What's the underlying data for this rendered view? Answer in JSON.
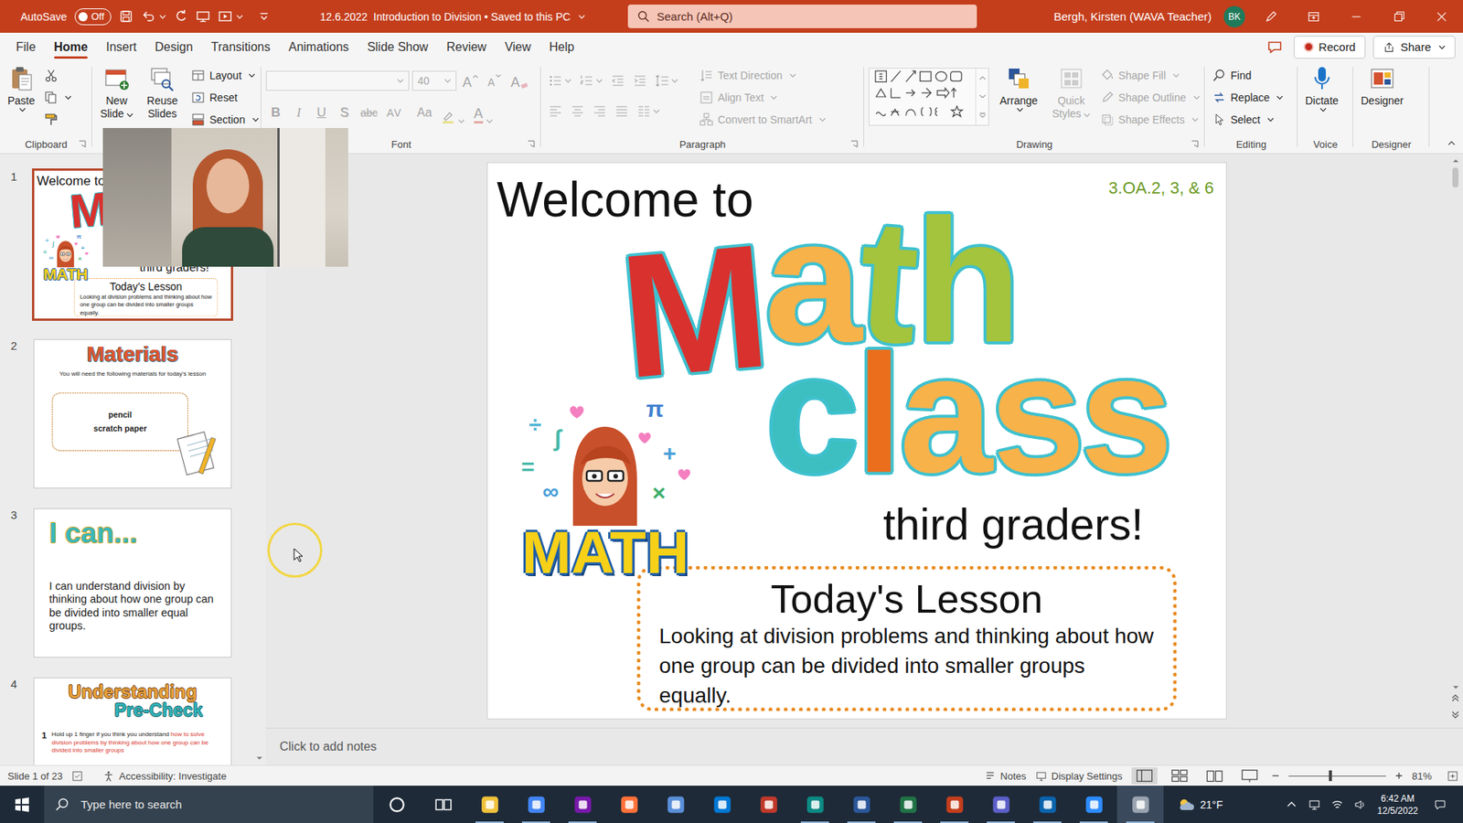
{
  "window": {
    "autosave_label": "AutoSave",
    "autosave": {
      "label": "Off",
      "on": false
    },
    "title": "12.6.2022  Introduction to Division • Saved to this PC",
    "search_placeholder": "Search (Alt+Q)",
    "user": "Bergh, Kirsten (WAVA Teacher)",
    "initials": "BK"
  },
  "menu": {
    "tabs": [
      {
        "label": "File",
        "selected": false
      },
      {
        "label": "Home",
        "selected": true
      },
      {
        "label": "Insert",
        "selected": false
      },
      {
        "label": "Design",
        "selected": false
      },
      {
        "label": "Transitions",
        "selected": false
      },
      {
        "label": "Animations",
        "selected": false
      },
      {
        "label": "Slide Show",
        "selected": false
      },
      {
        "label": "Review",
        "selected": false
      },
      {
        "label": "View",
        "selected": false
      },
      {
        "label": "Help",
        "selected": false
      }
    ],
    "record": "Record",
    "share": "Share"
  },
  "ribbon": {
    "clipboard": {
      "label": "Clipboard",
      "paste": "Paste"
    },
    "slides": {
      "new_slide": "New Slide",
      "reuse_slides": "Reuse Slides",
      "layout": "Layout",
      "reset": "Reset",
      "section": "Section"
    },
    "font": {
      "label": "Font",
      "disabled": true,
      "size": "40",
      "grow": "A",
      "shrink": "A",
      "clear": "A",
      "formats": [
        "B",
        "I",
        "U",
        "S",
        "abc",
        "AV",
        "Aa"
      ],
      "color": "A"
    },
    "paragraph": {
      "label": "Paragraph",
      "disabled": true,
      "text_direction": "Text Direction",
      "align_text": "Align Text",
      "smartart": "Convert to SmartArt"
    },
    "drawing": {
      "label": "Drawing",
      "arrange": "Arrange",
      "quick_styles": "Quick Styles",
      "quick_styles_disabled": true,
      "shape_fill": "Shape Fill",
      "shape_outline": "Shape Outline",
      "shape_effects": "Shape Effects",
      "shape_format_disabled": true
    },
    "editing": {
      "label": "Editing",
      "find": "Find",
      "replace": "Replace",
      "select": "Select"
    },
    "voice": {
      "label": "Voice",
      "dictate": "Dictate"
    },
    "designer": {
      "label": "Designer",
      "designer": "Designer"
    }
  },
  "thumbnails": [
    {
      "number": "1",
      "selected": true,
      "kind": "title"
    },
    {
      "number": "2",
      "selected": false,
      "kind": "materials",
      "heading": "Materials",
      "intro": "You will need the following materials for today's lesson",
      "items": [
        "pencil",
        "scratch paper"
      ]
    },
    {
      "number": "3",
      "selected": false,
      "kind": "goal",
      "heading": "I can...",
      "text": "I can understand division by thinking about how one group can be divided into smaller equal groups."
    },
    {
      "number": "4",
      "selected": false,
      "kind": "check",
      "heading": [
        "Understanding",
        "Pre-Check"
      ],
      "row_number": "1",
      "text": "Hold up 1 finger if you think you understand ",
      "highlight": "how to solve division problems by thinking about how one group can be divided into smaller groups"
    }
  ],
  "slide": {
    "welcome": "Welcome to",
    "standards": "3.OA.2, 3, & 6",
    "logo_top": [
      {
        "text": "M",
        "color": "#d8312e"
      },
      {
        "text": "a",
        "color": "#f8b24a"
      },
      {
        "text": "t",
        "color": "#a3c43c"
      },
      {
        "text": "h",
        "color": "#a3c43c"
      }
    ],
    "logo_bottom": [
      {
        "text": "c",
        "color": "#3dbfc2"
      },
      {
        "text": "l",
        "color": "#ea6e1c"
      },
      {
        "text": "a",
        "color": "#f8b24a"
      },
      {
        "text": "s",
        "color": "#f8b24a"
      },
      {
        "text": "s",
        "color": "#f8b24a"
      }
    ],
    "sticker": {
      "text": "MATH",
      "symbols": [
        "π",
        "÷",
        "∫",
        "=",
        "∞",
        "×",
        "+"
      ]
    },
    "audience": "third graders!",
    "lesson": {
      "title": "Today's Lesson",
      "text": "Looking at division problems and thinking about how one group can be divided into smaller groups equally."
    }
  },
  "notes": {
    "placeholder": "Click to add notes"
  },
  "status_bar": {
    "slide_info": "Slide 1 of 23",
    "accessibility": "Accessibility: Investigate",
    "notes": "Notes",
    "display_settings": "Display Settings",
    "zoom": "81%",
    "zoom_level": 0.43
  },
  "taskbar": {
    "search_placeholder": "Type here to search",
    "apps": [
      {
        "color": "#f0c23b",
        "running": true,
        "active": false
      },
      {
        "color": "#4285f4",
        "running": true,
        "active": false
      },
      {
        "color": "#7719aa",
        "running": true,
        "active": false
      },
      {
        "color": "#ff7139",
        "running": false,
        "active": false
      },
      {
        "color": "#5a8fd8",
        "running": false,
        "active": false
      },
      {
        "color": "#0078d4",
        "running": false,
        "active": false
      },
      {
        "color": "#c0392b",
        "running": false,
        "active": false
      },
      {
        "color": "#0c8a84",
        "running": true,
        "active": false
      },
      {
        "color": "#2b579a",
        "running": true,
        "active": false
      },
      {
        "color": "#217346",
        "running": true,
        "active": false
      },
      {
        "color": "#c43e1c",
        "running": true,
        "active": false
      },
      {
        "color": "#5b5fc7",
        "running": true,
        "active": false
      },
      {
        "color": "#0a64ad",
        "running": true,
        "active": false
      },
      {
        "color": "#2d8cff",
        "running": true,
        "active": false
      },
      {
        "color": "#9aa4b0",
        "running": true,
        "active": true
      }
    ],
    "weather": "21°F",
    "time": "6:42 AM",
    "date": "12/5/2022"
  }
}
